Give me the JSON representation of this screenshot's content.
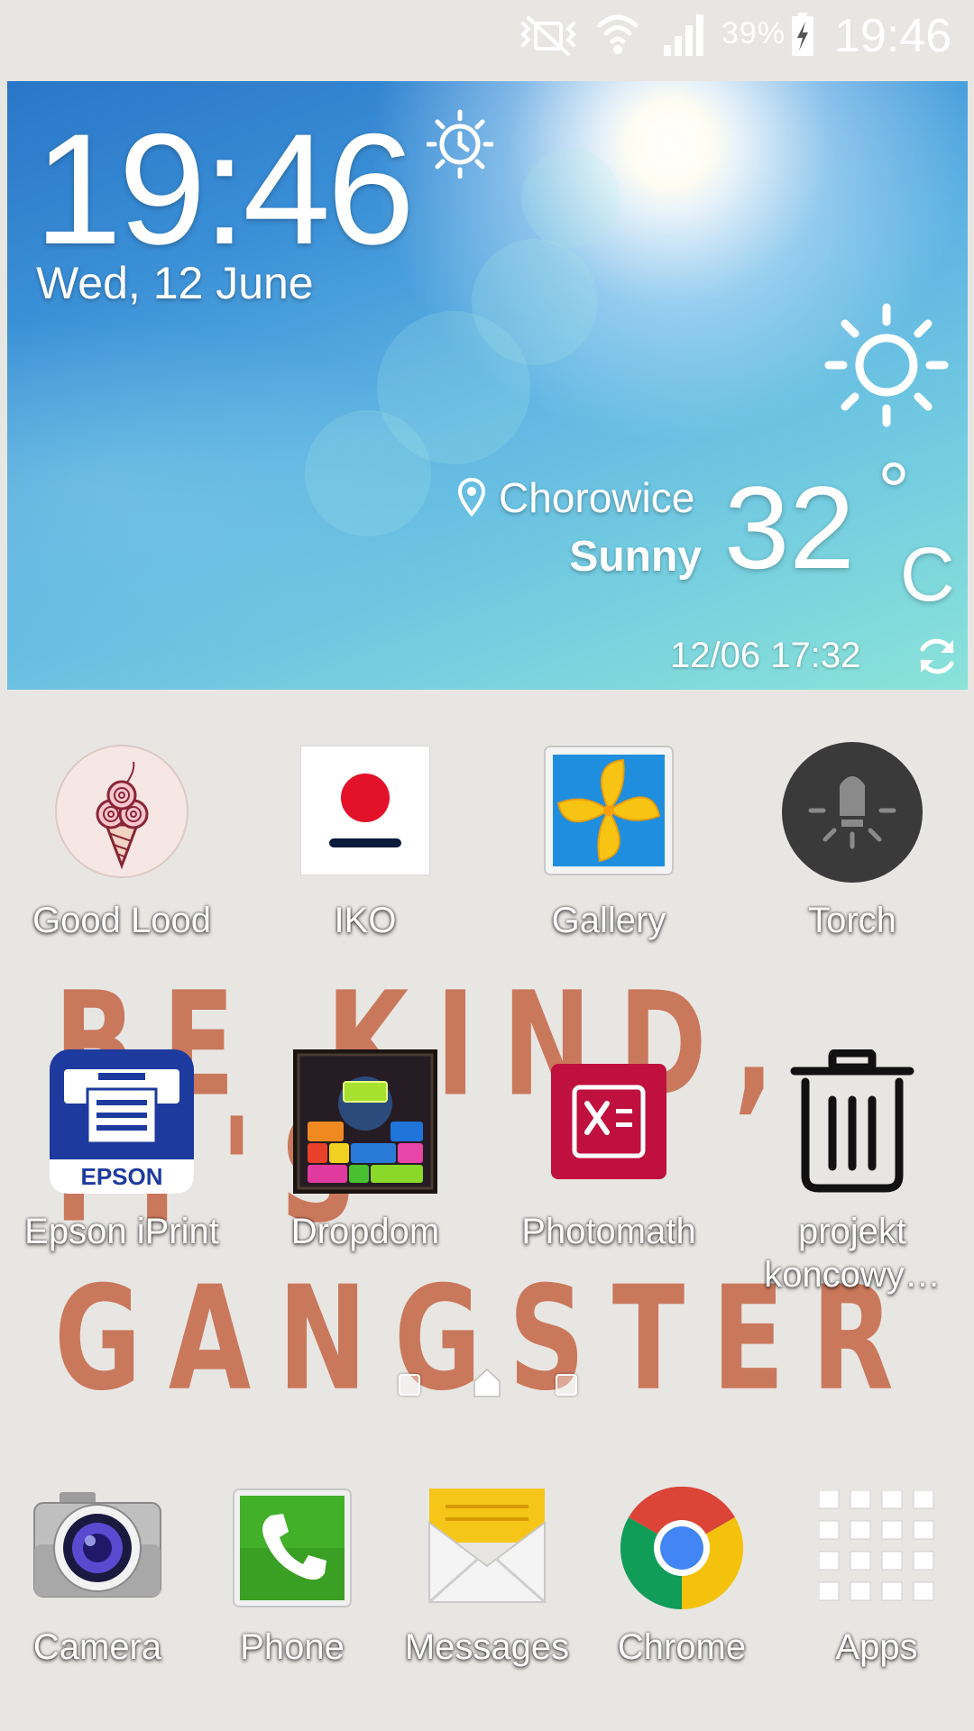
{
  "status_bar": {
    "battery_percent": "39%",
    "time": "19:46",
    "icons": [
      "mute-vibrate-icon",
      "wifi-icon",
      "signal-icon",
      "battery-charging-icon"
    ]
  },
  "widget": {
    "time": "19:46",
    "date": "Wed, 12 June",
    "location": "Chorowice",
    "condition": "Sunny",
    "temperature": "32",
    "degree_symbol": "°",
    "unit": "C",
    "updated": "12/06 17:32",
    "icons": [
      "alarm-icon",
      "sun-icon",
      "location-pin-icon",
      "refresh-icon"
    ]
  },
  "wallpaper_text": {
    "line1": "BE KIND,",
    "line2": "IT'S GANGSTER"
  },
  "apps": [
    {
      "label": "Good Lood",
      "icon": "ice-cream-icon"
    },
    {
      "label": "IKO",
      "icon": "iko-icon"
    },
    {
      "label": "Gallery",
      "icon": "gallery-flower-icon"
    },
    {
      "label": "Torch",
      "icon": "torch-bulb-icon"
    },
    {
      "label": "Epson iPrint",
      "icon": "epson-printer-icon"
    },
    {
      "label": "Dropdom",
      "icon": "dropdom-blocks-icon"
    },
    {
      "label": "Photomath",
      "icon": "photomath-icon"
    },
    {
      "label": "projekt koncowy…",
      "icon": "trash-can-icon"
    }
  ],
  "page_indicator": {
    "pages": 3,
    "current": 2
  },
  "dock": [
    {
      "label": "Camera",
      "icon": "camera-icon"
    },
    {
      "label": "Phone",
      "icon": "phone-icon"
    },
    {
      "label": "Messages",
      "icon": "envelope-icon"
    },
    {
      "label": "Chrome",
      "icon": "chrome-icon"
    },
    {
      "label": "Apps",
      "icon": "apps-grid-icon"
    }
  ],
  "colors": {
    "background": "#e8e6e3",
    "sky_blue": "#3a8fd6",
    "wallpaper_text": "#c56545",
    "iko_red": "#e4112a",
    "photomath_red": "#c0113e",
    "epson_blue": "#1d3a9e"
  }
}
